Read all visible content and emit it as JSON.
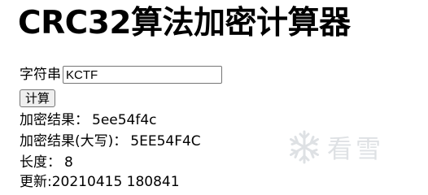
{
  "page": {
    "title": "CRC32算法加密计算器"
  },
  "form": {
    "input_label": "字符串",
    "input_value": "KCTF",
    "calc_button_label": "计算"
  },
  "results": {
    "encrypted_label": "加密结果：",
    "encrypted_value": "5ee54f4c",
    "encrypted_upper_label": "加密结果(大写)：",
    "encrypted_upper_value": "5EE54F4C",
    "length_label": "长度：",
    "length_value": "8",
    "updated_label": "更新:",
    "updated_value": "20210415 180841"
  },
  "watermark": {
    "icon": "snowflake-icon",
    "text": "看雪"
  }
}
